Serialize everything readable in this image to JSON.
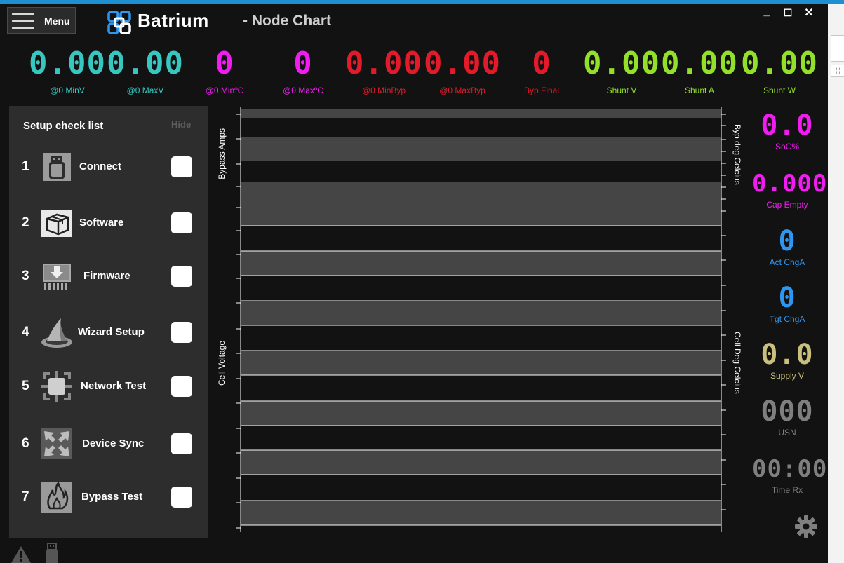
{
  "window": {
    "menu_label": "Menu",
    "brand": "Batrium",
    "title": "- Node Chart",
    "controls": {
      "minimize": "_",
      "maximize": "☐",
      "close": "✕"
    }
  },
  "top_metrics": [
    {
      "value": "0.00",
      "label": "@0 MinV",
      "color": "#37c7c0"
    },
    {
      "value": "0.00",
      "label": "@0 MaxV",
      "color": "#37c7c0"
    },
    {
      "value": "0",
      "label": "@0 MinºC",
      "color": "#f01cf0"
    },
    {
      "value": "0",
      "label": "@0 MaxºC",
      "color": "#f01cf0"
    },
    {
      "value": "0.00",
      "label": "@0 MinByp",
      "color": "#e21a2a"
    },
    {
      "value": "0.00",
      "label": "@0 MaxByp",
      "color": "#e21a2a"
    },
    {
      "value": "0",
      "label": "Byp Final",
      "color": "#e21a2a"
    },
    {
      "value": "0.00",
      "label": "Shunt V",
      "color": "#93e028"
    },
    {
      "value": "0.00",
      "label": "Shunt A",
      "color": "#93e028"
    },
    {
      "value": "0.00",
      "label": "Shunt W",
      "color": "#93e028"
    }
  ],
  "checklist": {
    "title": "Setup check list",
    "hide_label": "Hide",
    "steps": [
      {
        "num": "1",
        "label": "Connect",
        "icon": "usb-drive-icon",
        "checked": false
      },
      {
        "num": "2",
        "label": "Software",
        "icon": "box-icon",
        "checked": false
      },
      {
        "num": "3",
        "label": "Firmware",
        "icon": "chip-download-icon",
        "checked": false
      },
      {
        "num": "4",
        "label": "Wizard Setup",
        "icon": "wizard-hat-icon",
        "checked": false
      },
      {
        "num": "5",
        "label": "Network Test",
        "icon": "network-icon",
        "checked": false
      },
      {
        "num": "6",
        "label": "Device Sync",
        "icon": "sync-arrows-icon",
        "checked": false
      },
      {
        "num": "7",
        "label": "Bypass Test",
        "icon": "flame-icon",
        "checked": false
      }
    ]
  },
  "chart": {
    "axis_left_top": "Bypass Amps",
    "axis_left_bottom": "Cell Voltage",
    "axis_right_top": "Byp deg Celcius",
    "axis_right_bottom": "Cell Deg Celcius"
  },
  "side_metrics": [
    {
      "value": "0.0",
      "label": "SoC%",
      "color": "#f01cf0"
    },
    {
      "value": "0.000",
      "label": "Cap Empty",
      "color": "#f01cf0"
    },
    {
      "value": "0",
      "label": "Act ChgA",
      "color": "#2f96f0"
    },
    {
      "value": "0",
      "label": "Tgt ChgA",
      "color": "#2f96f0"
    },
    {
      "value": "0.0",
      "label": "Supply V",
      "color": "#c8c07c"
    },
    {
      "value": "000",
      "label": "USN",
      "color": "#7f7f7f"
    },
    {
      "value": "00:00",
      "label": "Time Rx",
      "color": "#7f7f7f"
    }
  ],
  "colors": {
    "accent": "#1e8fd0",
    "background": "#121212",
    "panel": "#2d2d2d"
  }
}
